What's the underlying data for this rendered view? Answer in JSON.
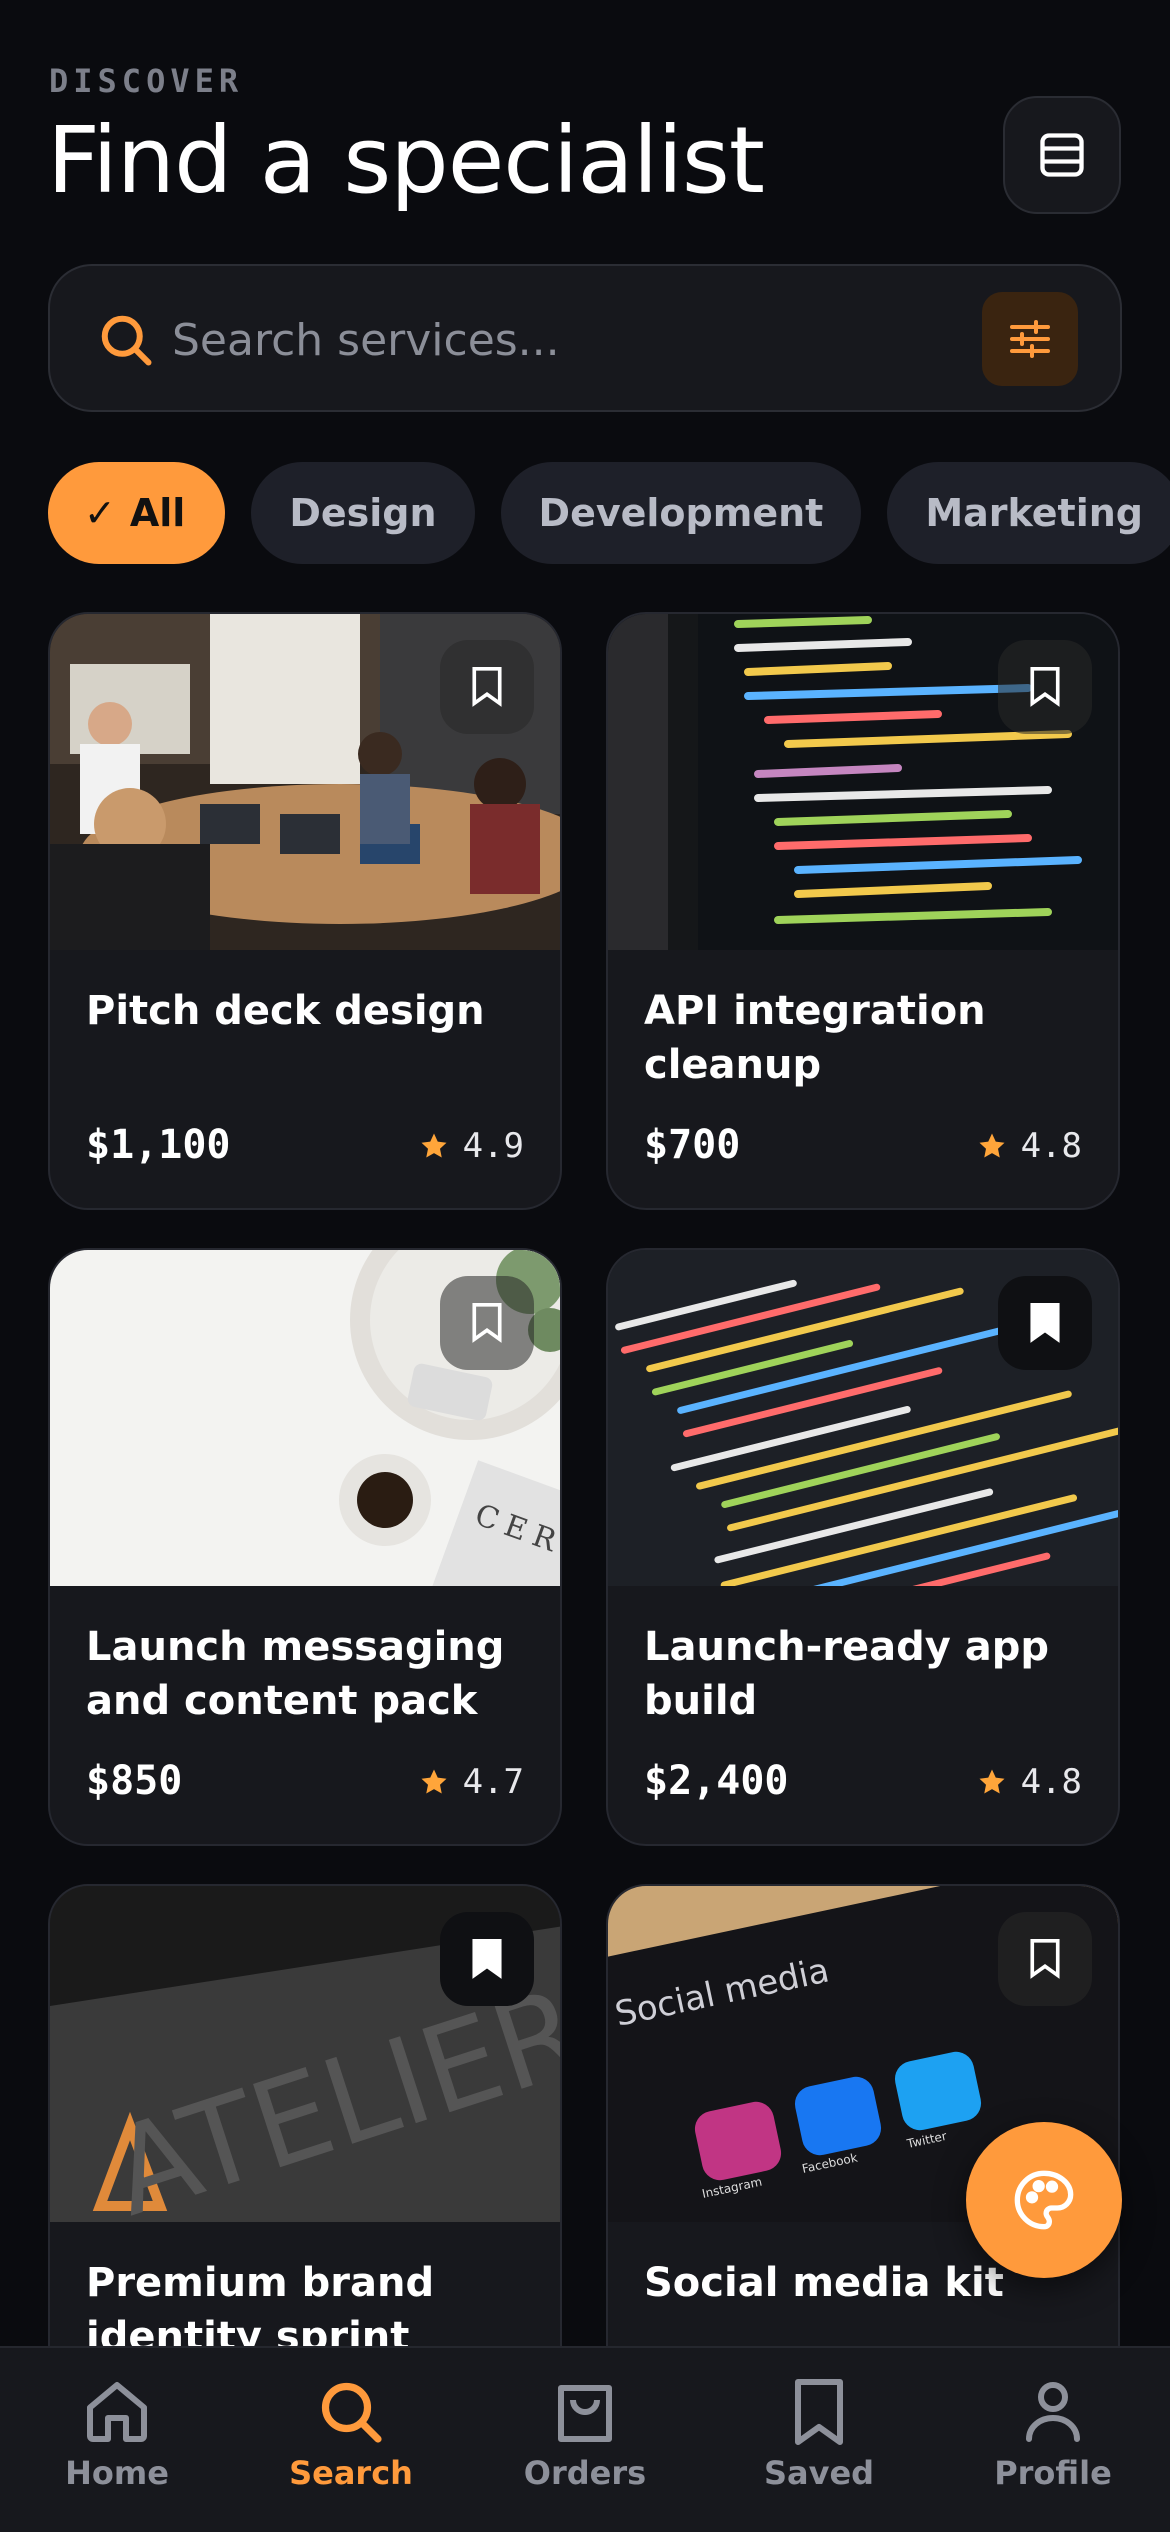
{
  "header": {
    "eyebrow": "DISCOVER",
    "title": "Find a specialist",
    "menu_icon": "menu-list-icon"
  },
  "search": {
    "placeholder": "Search services...",
    "value": "",
    "filter_icon": "sliders-icon"
  },
  "chips": [
    {
      "label": "All",
      "active": true
    },
    {
      "label": "Design",
      "active": false
    },
    {
      "label": "Development",
      "active": false
    },
    {
      "label": "Marketing",
      "active": false
    }
  ],
  "cards": [
    {
      "title": "Pitch deck design",
      "price": "$1,100",
      "rating": "4.9",
      "saved": false
    },
    {
      "title": "API integration cleanup",
      "price": "$700",
      "rating": "4.8",
      "saved": false
    },
    {
      "title": "Launch messaging and content pack",
      "price": "$850",
      "rating": "4.7",
      "saved": false
    },
    {
      "title": "Launch-ready app build",
      "price": "$2,400",
      "rating": "4.8",
      "saved": true
    },
    {
      "title": "Premium brand identity sprint",
      "price": "",
      "rating": "",
      "saved": true
    },
    {
      "title": "Social media kit",
      "price": "",
      "rating": "",
      "saved": false
    }
  ],
  "image_text": {
    "atelier_sign": "ATELIER",
    "cere": "CERE",
    "social_media": "Social media",
    "instagram": "Instagram",
    "facebook": "Facebook",
    "twitter": "Twitter"
  },
  "fab": {
    "icon": "palette-icon"
  },
  "nav": [
    {
      "label": "Home",
      "icon": "home-icon",
      "active": false
    },
    {
      "label": "Search",
      "icon": "search-icon",
      "active": true
    },
    {
      "label": "Orders",
      "icon": "shopping-bag-icon",
      "active": false
    },
    {
      "label": "Saved",
      "icon": "bookmark-icon",
      "active": false
    },
    {
      "label": "Profile",
      "icon": "user-icon",
      "active": false
    }
  ],
  "colors": {
    "accent": "#ff9a3c",
    "background": "#0a0b0f",
    "card": "#17181d",
    "star": "#ffa53a"
  }
}
